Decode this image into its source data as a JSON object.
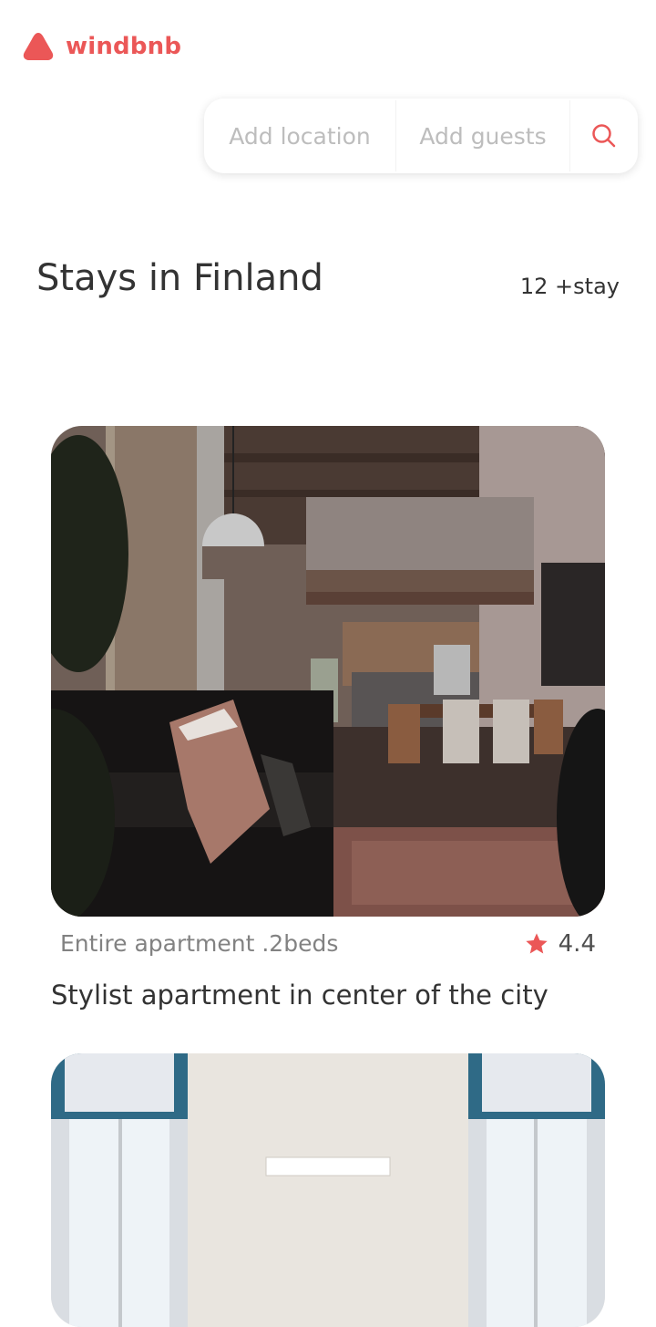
{
  "app": {
    "logo_text": "windbnb"
  },
  "search": {
    "location_placeholder": "Add location",
    "guests_placeholder": "Add guests",
    "button_icon": "search-icon"
  },
  "page": {
    "title": "Stays in Finland",
    "count": "12 +stay"
  },
  "stays": [
    {
      "type": "Entire apartment .2beds",
      "rating": "4.4",
      "rating_icon": "star-icon",
      "title": "Stylist apartment in center of the city"
    }
  ],
  "colors": {
    "accent": "#EB5757",
    "text": "#333333",
    "muted": "#828282",
    "placeholder": "#BDBDBD"
  }
}
